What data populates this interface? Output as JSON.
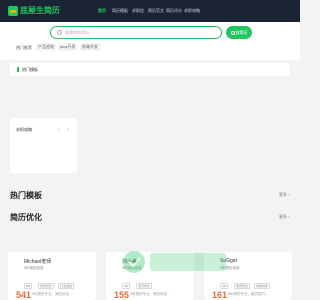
{
  "header": {
    "logo_text": "底屋生简历",
    "nav": [
      "首页",
      "简历模板",
      "求职信",
      "简历范文",
      "简历评分",
      "求职攻略"
    ]
  },
  "search": {
    "placeholder": "搜索你的简历",
    "button_label": "搜简历"
  },
  "hot_searches": {
    "label": "热门推荐",
    "tags": [
      "产品经理",
      "java开发",
      "前端开发"
    ]
  },
  "hot_templates_card": {
    "title": "热门模板"
  },
  "side_panel": {
    "title": "求职攻略",
    "prev": "‹",
    "next": "›"
  },
  "section_hot": {
    "title": "热门模板",
    "more": "更多 ›"
  },
  "section_resume": {
    "title": "简历优化",
    "more": "更多 ›",
    "cards": [
      {
        "name": "Michael老师",
        "sub": "9年简历经验",
        "count": "541",
        "tags": [
          "HR",
          "简历优化",
          "行业经验"
        ],
        "desc": "9年简历专业，简历优化..."
      },
      {
        "name": "刘小美",
        "sub": "8年简历经验",
        "count": "155",
        "tags": [
          "HR",
          "简历优化"
        ],
        "desc": "8年简历专业，简历优化..."
      },
      {
        "name": "SuGgar",
        "sub": "6年简历经验",
        "count": "161",
        "tags": [
          "HR",
          "简历优化",
          "求职指导"
        ],
        "desc": "6年简历专业，面试技巧..."
      }
    ]
  },
  "colors": {
    "accent": "#22c55e",
    "topbar": "#1a2434",
    "number": "#e86a3a"
  }
}
